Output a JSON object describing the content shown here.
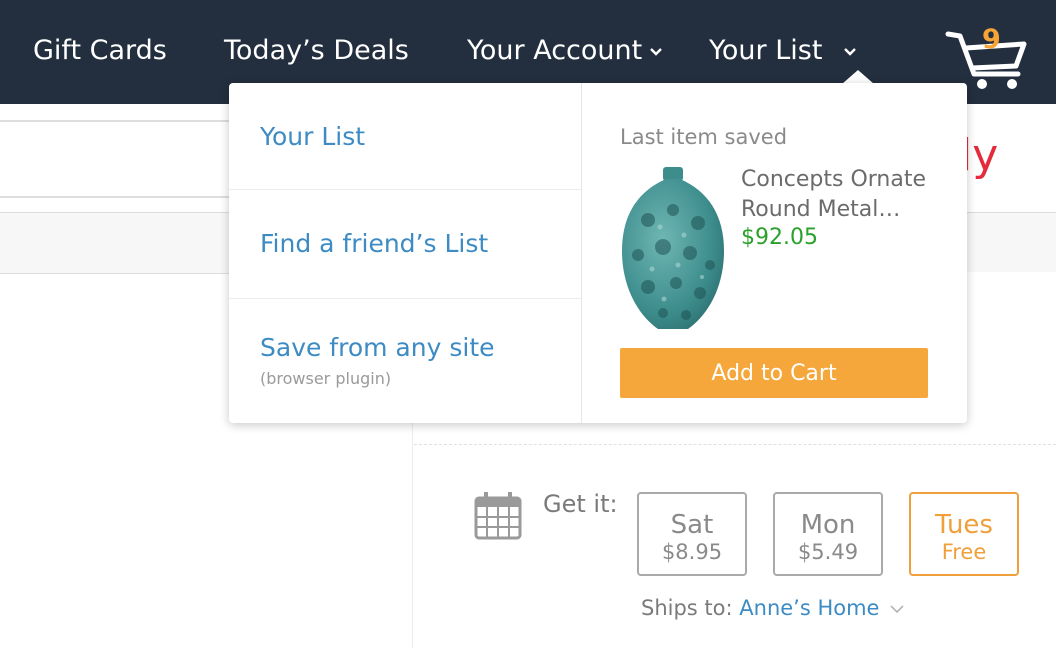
{
  "nav": {
    "items": [
      "Gift Cards",
      "Today’s Deals",
      "Your Account",
      "Your List"
    ],
    "cart_icon": "cart-icon",
    "cart_count": "9",
    "chevron_icon": "chevron-down-icon"
  },
  "dropdown": {
    "links": [
      "Your List",
      "Find a friend’s List",
      "Save from any site"
    ],
    "save_sub": "(browser plugin)",
    "last_saved_label": "Last item saved",
    "product": {
      "name": "Concepts Ornate Round Metal…",
      "price": "$92.05",
      "image": "vase-image"
    },
    "add_to_cart_label": "Add to Cart"
  },
  "delivery": {
    "get_it_label": "Get it:",
    "calendar_icon": "calendar-icon",
    "options": [
      {
        "day": "Sat",
        "price": "$8.95",
        "selected": false
      },
      {
        "day": "Mon",
        "price": "$5.49",
        "selected": false
      },
      {
        "day": "Tues",
        "price": "Free",
        "selected": true
      }
    ],
    "ships_to_label": "Ships to:",
    "ships_to_value": "Anne’s Home"
  },
  "colors": {
    "nav_bg": "#232f3e",
    "link": "#3d8bc4",
    "accent_orange": "#f5a73b",
    "price_green": "#2aa12a",
    "logo_red": "#e42b3b"
  }
}
